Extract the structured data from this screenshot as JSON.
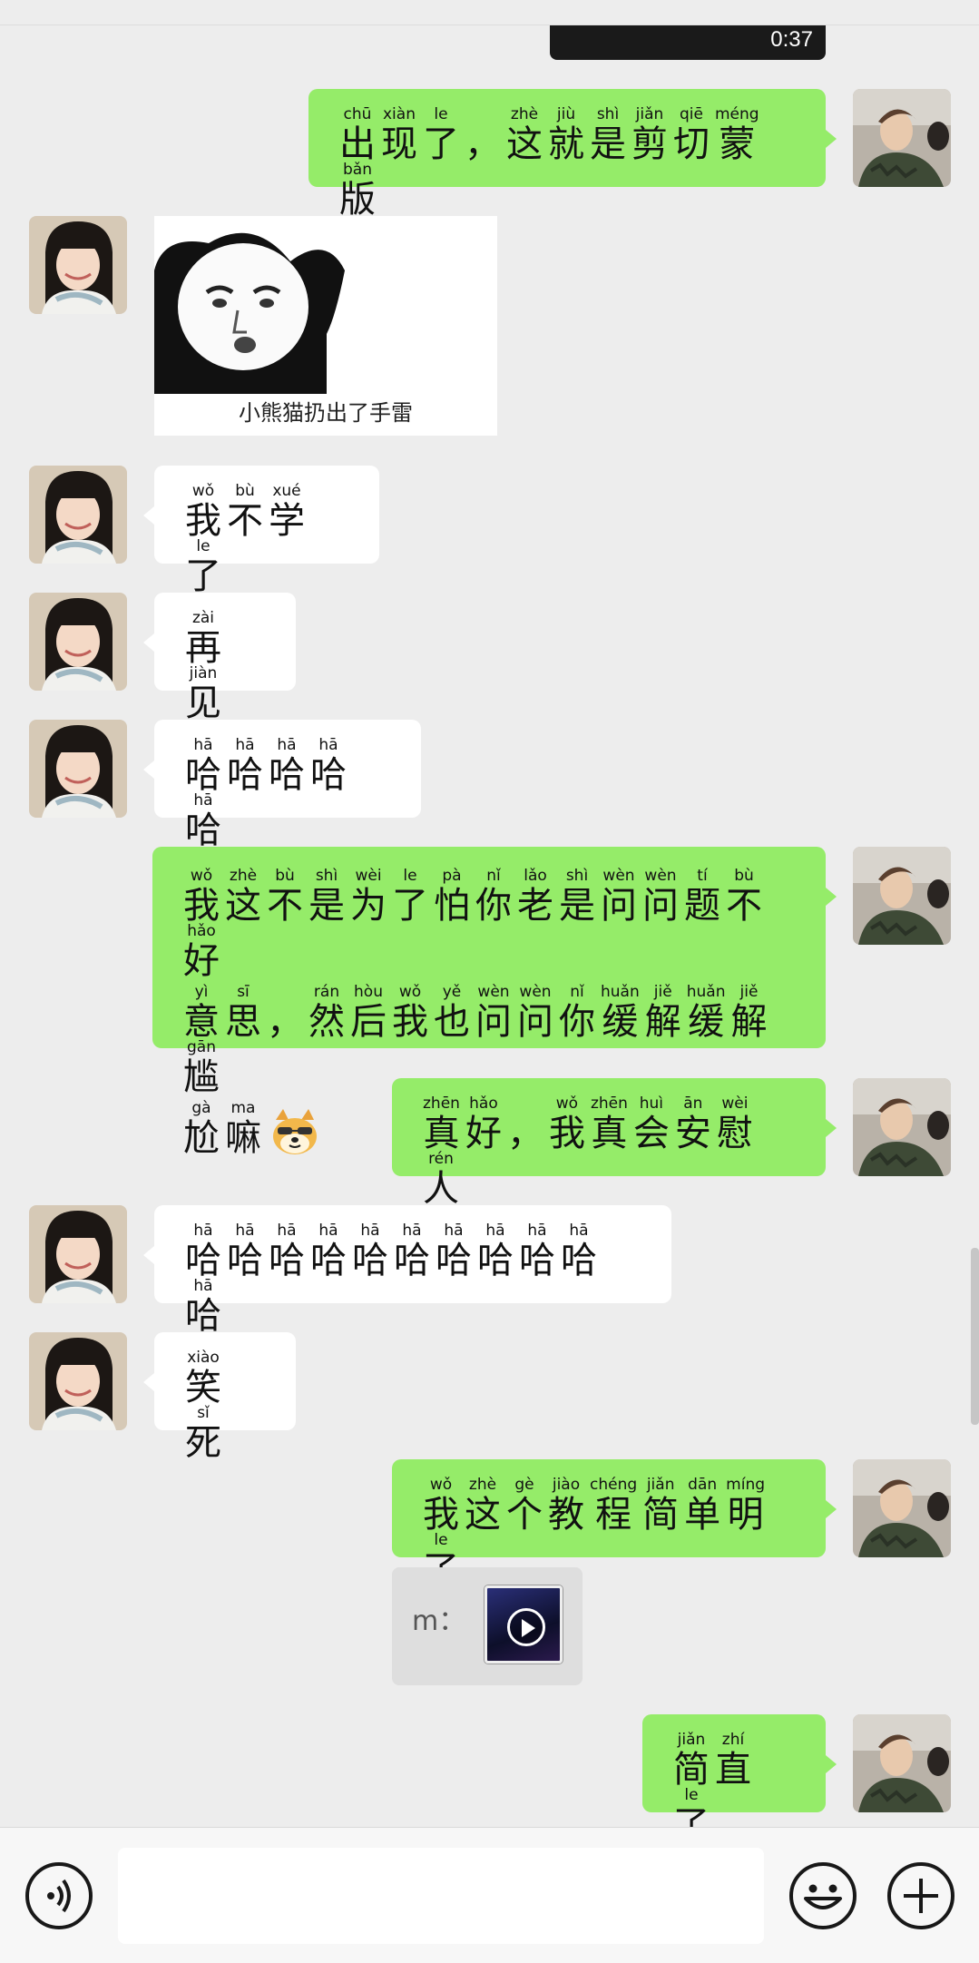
{
  "video_message": {
    "duration": "0:37"
  },
  "sticker": {
    "caption": "小熊猫扔出了手雷"
  },
  "messages": {
    "m1": {
      "chars": [
        [
          "出",
          "chū"
        ],
        [
          "现",
          "xiàn"
        ],
        [
          "了",
          "le"
        ],
        [
          "，",
          ""
        ],
        [
          "这",
          "zhè"
        ],
        [
          "就",
          "jiù"
        ],
        [
          "是",
          "shì"
        ],
        [
          "剪",
          "jiǎn"
        ],
        [
          "切",
          "qiē"
        ],
        [
          "蒙",
          "méng"
        ],
        [
          "版",
          "bǎn"
        ]
      ]
    },
    "m2": {
      "chars": [
        [
          "我",
          "wǒ"
        ],
        [
          "不",
          "bù"
        ],
        [
          "学",
          "xué"
        ],
        [
          "了",
          "le"
        ]
      ]
    },
    "m3": {
      "chars": [
        [
          "再",
          "zài"
        ],
        [
          "见",
          "jiàn"
        ]
      ]
    },
    "m4": {
      "chars": [
        [
          "哈",
          "hā"
        ],
        [
          "哈",
          "hā"
        ],
        [
          "哈",
          "hā"
        ],
        [
          "哈",
          "hā"
        ],
        [
          "哈",
          "hā"
        ]
      ]
    },
    "m5": {
      "line1": [
        [
          "我",
          "wǒ"
        ],
        [
          "这",
          "zhè"
        ],
        [
          "不",
          "bù"
        ],
        [
          "是",
          "shì"
        ],
        [
          "为",
          "wèi"
        ],
        [
          "了",
          "le"
        ],
        [
          "怕",
          "pà"
        ],
        [
          "你",
          "nǐ"
        ],
        [
          "老",
          "lǎo"
        ],
        [
          "是",
          "shì"
        ],
        [
          "问",
          "wèn"
        ],
        [
          "问",
          "wèn"
        ],
        [
          "题",
          "tí"
        ],
        [
          "不",
          "bù"
        ],
        [
          "好",
          "hǎo"
        ]
      ],
      "line2": [
        [
          "意",
          "yì"
        ],
        [
          "思",
          "sī"
        ],
        [
          "，",
          ""
        ],
        [
          "然",
          "rán"
        ],
        [
          "后",
          "hòu"
        ],
        [
          "我",
          "wǒ"
        ],
        [
          "也",
          "yě"
        ],
        [
          "问",
          "wèn"
        ],
        [
          "问",
          "wèn"
        ],
        [
          "你",
          "nǐ"
        ],
        [
          "缓",
          "huǎn"
        ],
        [
          "解",
          "jiě"
        ],
        [
          "缓",
          "huǎn"
        ],
        [
          "解",
          "jiě"
        ],
        [
          "尴",
          "gān"
        ]
      ],
      "line3": [
        [
          "尬",
          "gà"
        ],
        [
          "嘛",
          "ma"
        ]
      ],
      "emoji": "doge-emoji"
    },
    "m6": {
      "chars": [
        [
          "真",
          "zhēn"
        ],
        [
          "好",
          "hǎo"
        ],
        [
          "，",
          ""
        ],
        [
          "我",
          "wǒ"
        ],
        [
          "真",
          "zhēn"
        ],
        [
          "会",
          "huì"
        ],
        [
          "安",
          "ān"
        ],
        [
          "慰",
          "wèi"
        ],
        [
          "人",
          "rén"
        ]
      ]
    },
    "m7": {
      "chars": [
        [
          "哈",
          "hā"
        ],
        [
          "哈",
          "hā"
        ],
        [
          "哈",
          "hā"
        ],
        [
          "哈",
          "hā"
        ],
        [
          "哈",
          "hā"
        ],
        [
          "哈",
          "hā"
        ],
        [
          "哈",
          "hā"
        ],
        [
          "哈",
          "hā"
        ],
        [
          "哈",
          "hā"
        ],
        [
          "哈",
          "hā"
        ],
        [
          "哈",
          "hā"
        ]
      ]
    },
    "m8": {
      "chars": [
        [
          "笑",
          "xiào"
        ],
        [
          "死",
          "sǐ"
        ]
      ]
    },
    "m9": {
      "chars": [
        [
          "我",
          "wǒ"
        ],
        [
          "这",
          "zhè"
        ],
        [
          "个",
          "gè"
        ],
        [
          "教",
          "jiào"
        ],
        [
          "程",
          "chéng"
        ],
        [
          "简",
          "jiǎn"
        ],
        [
          "单",
          "dān"
        ],
        [
          "明",
          "míng"
        ],
        [
          "了",
          "le"
        ]
      ]
    },
    "m10": {
      "chars": [
        [
          "简",
          "jiǎn"
        ],
        [
          "直",
          "zhí"
        ],
        [
          "了",
          "le"
        ]
      ]
    }
  },
  "link_card": {
    "label": "m："
  },
  "input_bar": {
    "voice_icon": "voice-icon",
    "emoji_icon": "smiley-icon",
    "more_icon": "plus-icon"
  },
  "colors": {
    "self_bubble": "#95ec69",
    "other_bubble": "#ffffff",
    "background": "#ededed"
  }
}
